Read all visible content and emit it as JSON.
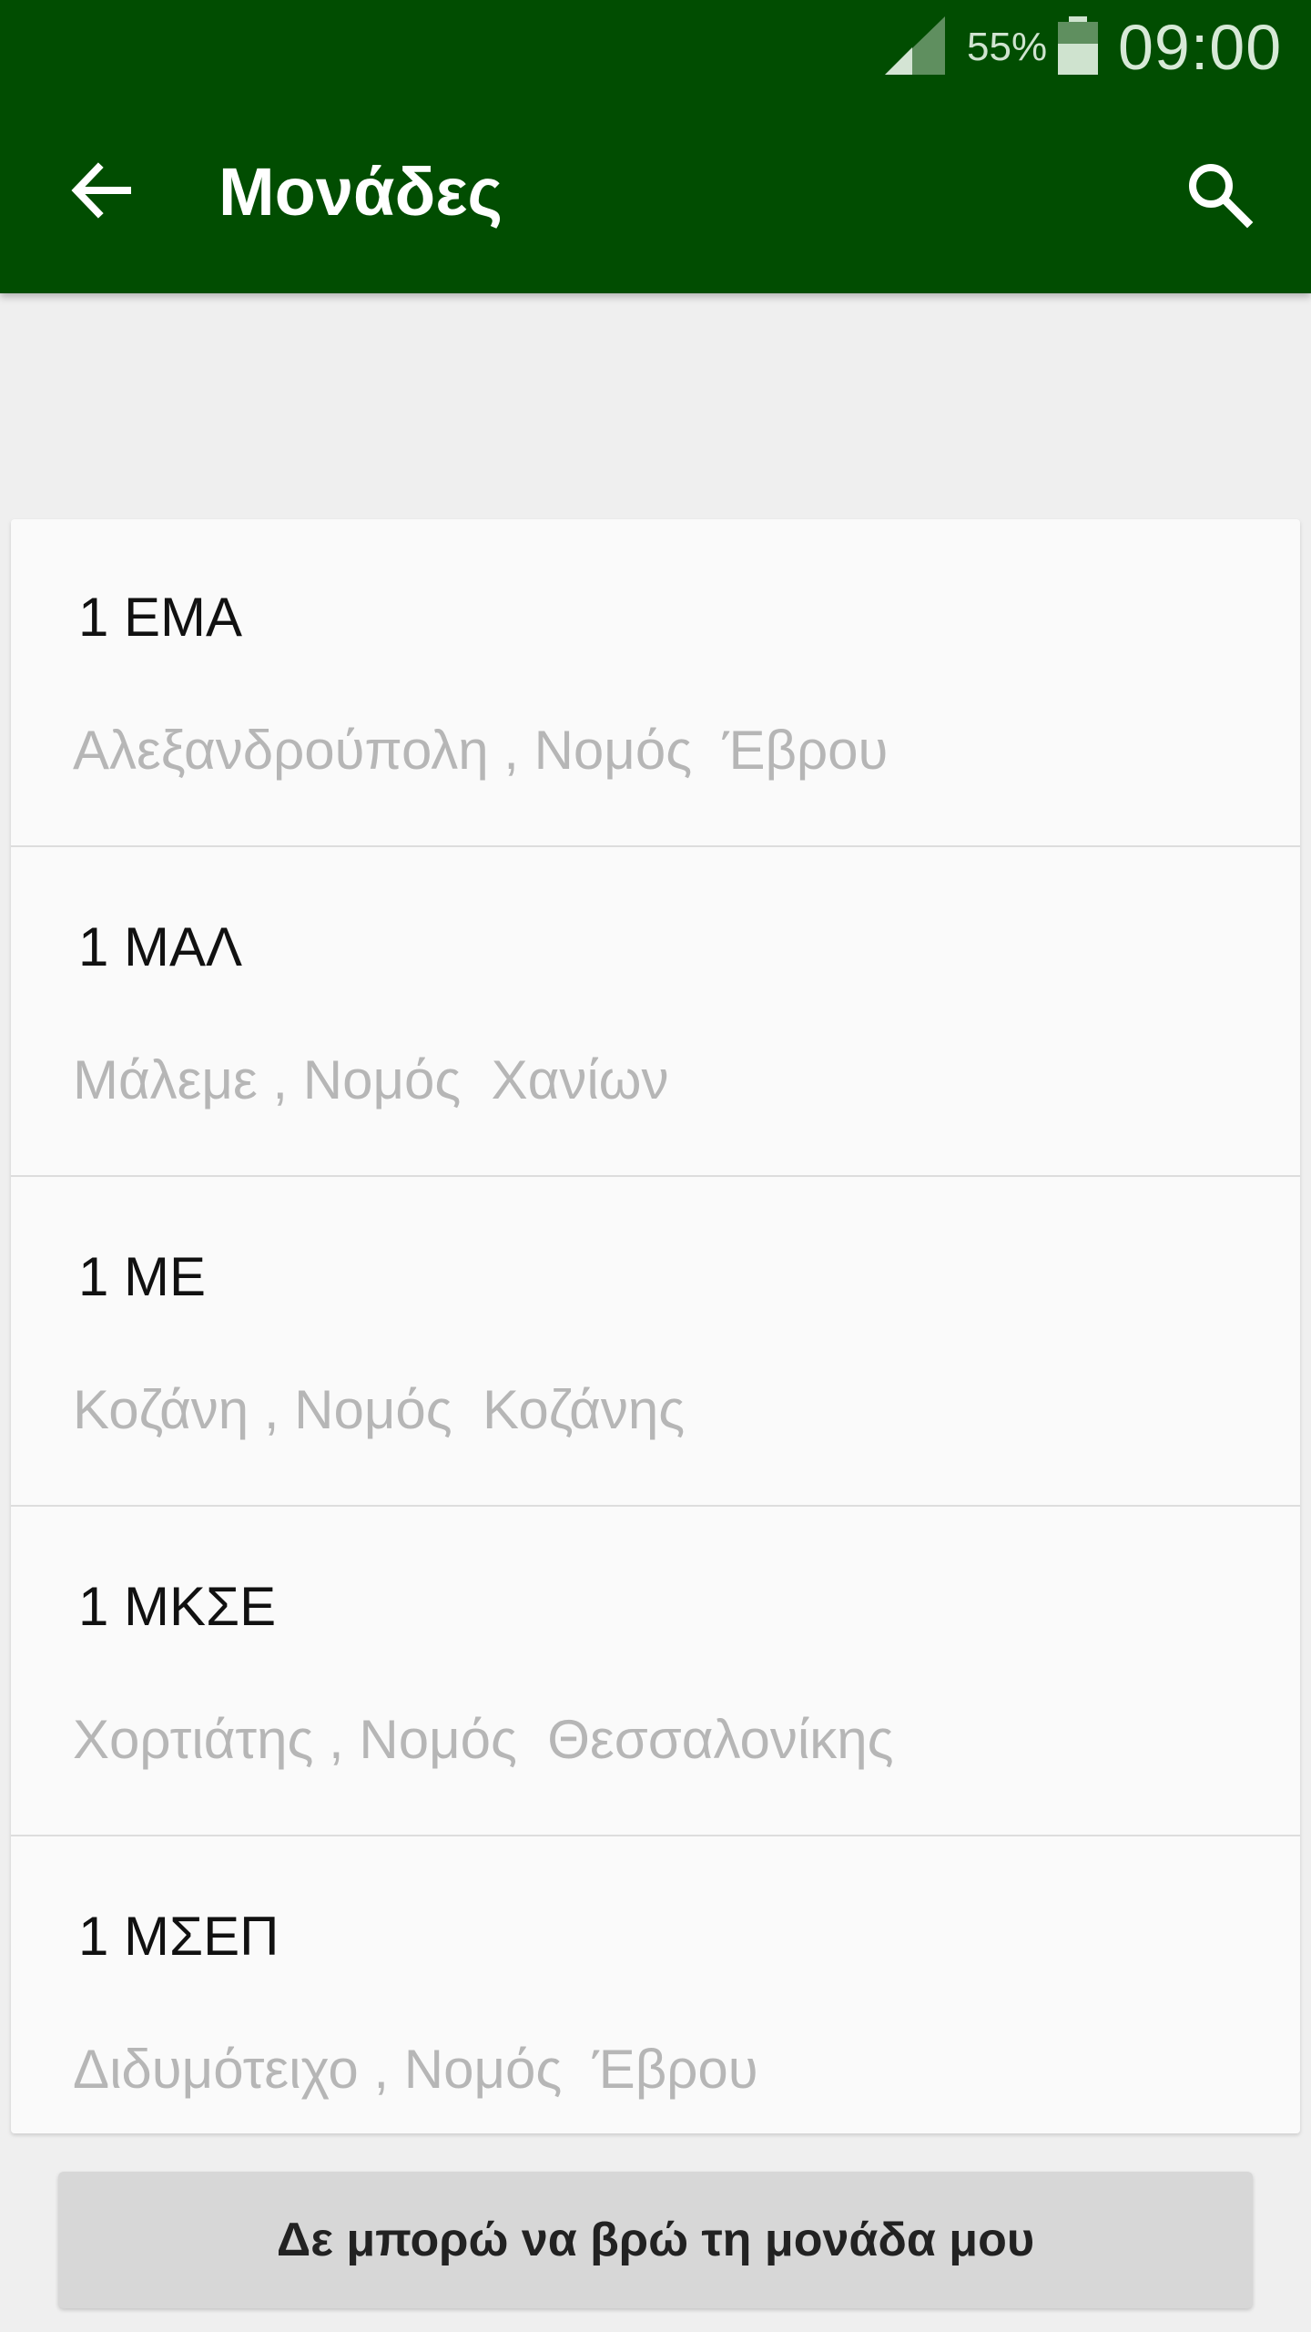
{
  "status_bar": {
    "battery_percent": "55%",
    "time": "09:00"
  },
  "app_bar": {
    "title": "Μονάδες",
    "back_icon": "arrow-left-icon",
    "search_icon": "search-icon"
  },
  "colors": {
    "primary": "#014d01",
    "background": "#efefef",
    "card": "#fafafa",
    "secondary_text": "#b6b6b6"
  },
  "units": [
    {
      "name": "1 ΕΜΑ",
      "location": "Αλεξανδρούπολη , Νομός  Έβρου"
    },
    {
      "name": "1 ΜΑΛ",
      "location": "Μάλεμε , Νομός  Χανίων"
    },
    {
      "name": "1 ΜΕ",
      "location": "Κοζάνη , Νομός  Κοζάνης"
    },
    {
      "name": "1 ΜΚΣΕ",
      "location": "Χορτιάτης , Νομός  Θεσσαλονίκης"
    },
    {
      "name": "1 ΜΣΕΠ",
      "location": "Διδυμότειχο , Νομός  Έβρου"
    }
  ],
  "footer": {
    "button_label": "Δε μπορώ να βρώ τη μονάδα μου"
  }
}
